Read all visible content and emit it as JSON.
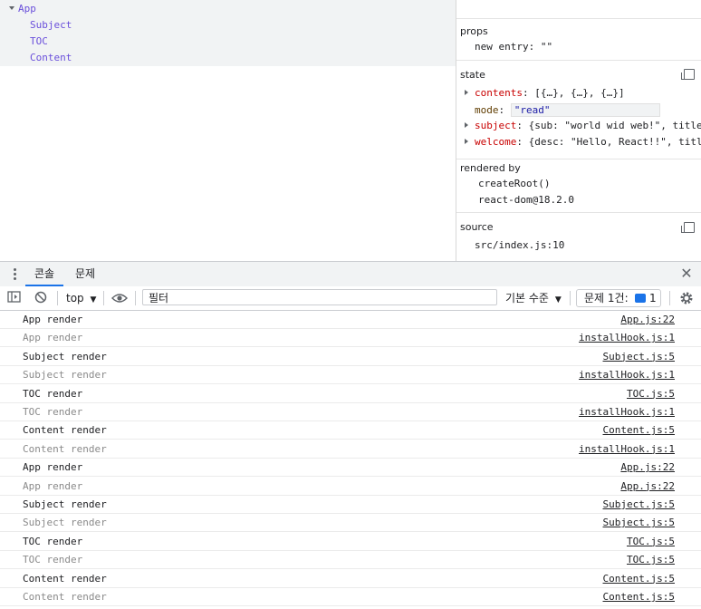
{
  "tree": {
    "root": "App",
    "children": [
      "Subject",
      "TOC",
      "Content"
    ]
  },
  "side": {
    "props": {
      "title": "props",
      "key": "new entry",
      "value": "\"\""
    },
    "state": {
      "title": "state",
      "rows": [
        {
          "key": "contents",
          "value": "[{…}, {…}, {…}]",
          "expandable": true
        },
        {
          "key": "mode",
          "value": "\"read\"",
          "expandable": false
        },
        {
          "key": "subject",
          "value": "{sub: \"world wid web!\", title:…",
          "expandable": true
        },
        {
          "key": "welcome",
          "value": "{desc: \"Hello, React!!\", title…",
          "expandable": true
        }
      ]
    },
    "rendered_by": {
      "title": "rendered by",
      "items": [
        "createRoot()",
        "react-dom@18.2.0"
      ]
    },
    "source": {
      "title": "source",
      "value": "src/index.js:10"
    }
  },
  "drawer": {
    "tabs": [
      "콘솔",
      "문제"
    ]
  },
  "toolbar": {
    "context": "top",
    "filter_placeholder": "필터",
    "levels": "기본 수준",
    "issues_label": "문제 1건:",
    "issues_count": "1"
  },
  "log": [
    {
      "msg": "App render",
      "src": "App.js:22",
      "dim": false
    },
    {
      "msg": "App render",
      "src": "installHook.js:1",
      "dim": true
    },
    {
      "msg": "Subject render",
      "src": "Subject.js:5",
      "dim": false
    },
    {
      "msg": "Subject render",
      "src": "installHook.js:1",
      "dim": true
    },
    {
      "msg": "TOC render",
      "src": "TOC.js:5",
      "dim": false
    },
    {
      "msg": "TOC render",
      "src": "installHook.js:1",
      "dim": true
    },
    {
      "msg": "Content render",
      "src": "Content.js:5",
      "dim": false
    },
    {
      "msg": "Content render",
      "src": "installHook.js:1",
      "dim": true
    },
    {
      "msg": "App render",
      "src": "App.js:22",
      "dim": false
    },
    {
      "msg": "App render",
      "src": "App.js:22",
      "dim": true
    },
    {
      "msg": "Subject render",
      "src": "Subject.js:5",
      "dim": false
    },
    {
      "msg": "Subject render",
      "src": "Subject.js:5",
      "dim": true
    },
    {
      "msg": "TOC render",
      "src": "TOC.js:5",
      "dim": false
    },
    {
      "msg": "TOC render",
      "src": "TOC.js:5",
      "dim": true
    },
    {
      "msg": "Content render",
      "src": "Content.js:5",
      "dim": false
    },
    {
      "msg": "Content render",
      "src": "Content.js:5",
      "dim": true
    }
  ]
}
